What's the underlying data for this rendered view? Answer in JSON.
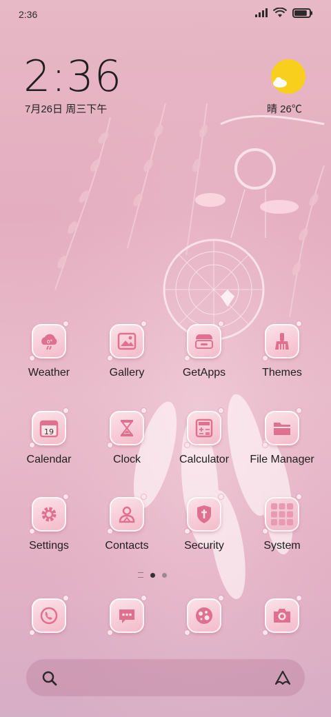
{
  "status_bar": {
    "time": "2:36",
    "battery_level": 0.85
  },
  "clock_widget": {
    "time": "2:36",
    "date": "7月26日 周三下午"
  },
  "weather_widget": {
    "temperature": "晴 26℃",
    "icon": "sunny-cloud-icon"
  },
  "apps": [
    {
      "label": "Weather",
      "icon": "weather-icon"
    },
    {
      "label": "Gallery",
      "icon": "gallery-icon"
    },
    {
      "label": "GetApps",
      "icon": "getapps-icon"
    },
    {
      "label": "Themes",
      "icon": "themes-icon"
    },
    {
      "label": "Calendar",
      "icon": "calendar-icon",
      "badge": "19"
    },
    {
      "label": "Clock",
      "icon": "clock-icon"
    },
    {
      "label": "Calculator",
      "icon": "calculator-icon"
    },
    {
      "label": "File Manager",
      "icon": "file-manager-icon"
    },
    {
      "label": "Settings",
      "icon": "settings-icon"
    },
    {
      "label": "Contacts",
      "icon": "contacts-icon"
    },
    {
      "label": "Security",
      "icon": "security-icon"
    },
    {
      "label": "System",
      "icon": "system-folder-icon"
    }
  ],
  "dock": [
    {
      "icon": "phone-icon"
    },
    {
      "icon": "messages-icon"
    },
    {
      "icon": "browser-icon"
    },
    {
      "icon": "camera-icon"
    }
  ],
  "page_indicator": {
    "pages": 2,
    "current": 1
  },
  "search_bar": {
    "left_icon": "search-icon",
    "right_icon": "assistant-icon"
  },
  "colors": {
    "icon_pink": "#f3b9c9",
    "icon_line": "#e0708f",
    "background": "#e4aec0"
  }
}
